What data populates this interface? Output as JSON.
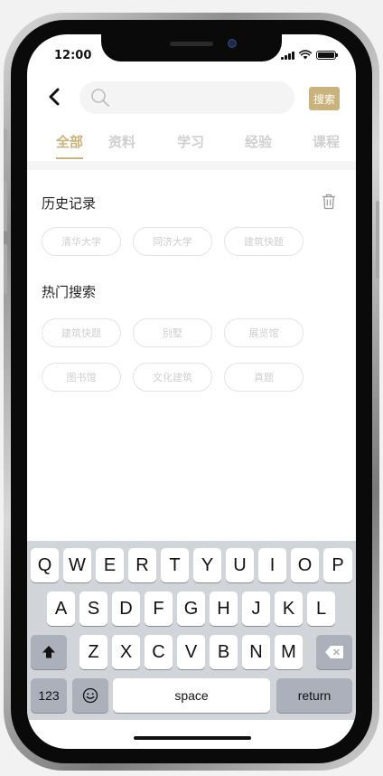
{
  "status_bar": {
    "time": "12:00"
  },
  "search": {
    "value": "",
    "button_label": "搜索"
  },
  "tabs": [
    {
      "label": "全部",
      "active": true
    },
    {
      "label": "资料",
      "active": false
    },
    {
      "label": "学习",
      "active": false
    },
    {
      "label": "经验",
      "active": false
    },
    {
      "label": "课程",
      "active": false
    }
  ],
  "history": {
    "title": "历史记录",
    "items": [
      "清华大学",
      "同济大学",
      "建筑快题"
    ]
  },
  "hot": {
    "title": "热门搜索",
    "items": [
      "建筑快题",
      "别墅",
      "展览馆",
      "图书馆",
      "文化建筑",
      "真题"
    ]
  },
  "keyboard": {
    "row1": [
      "Q",
      "W",
      "E",
      "R",
      "T",
      "Y",
      "U",
      "I",
      "O",
      "P"
    ],
    "row2": [
      "A",
      "S",
      "D",
      "F",
      "G",
      "H",
      "J",
      "K",
      "L"
    ],
    "row3": [
      "Z",
      "X",
      "C",
      "V",
      "B",
      "N",
      "M"
    ],
    "numbers_label": "123",
    "space_label": "space",
    "return_label": "return"
  },
  "colors": {
    "accent": "#c9b27c",
    "chip_text": "#cfcfcf",
    "keyboard_bg": "#d1d4d9"
  }
}
